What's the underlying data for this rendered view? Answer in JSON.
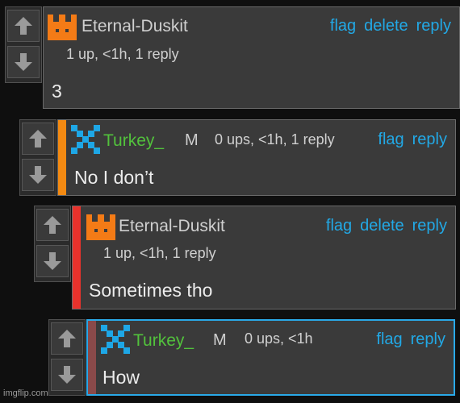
{
  "comments": [
    {
      "username": "Eternal-Duskit",
      "meta": "1 up, <1h, 1 reply",
      "text": "3",
      "actions": [
        "flag",
        "delete",
        "reply"
      ],
      "avatar_icon": "orange-castle-avatar-icon",
      "bar_color": ""
    },
    {
      "username": "Turkey_",
      "badge": "M",
      "meta": "0 ups, <1h, 1 reply",
      "text": "No I don’t",
      "actions": [
        "flag",
        "reply"
      ],
      "avatar_icon": "blue-x-avatar-icon",
      "bar_color": "#f48a12"
    },
    {
      "username": "Eternal-Duskit",
      "meta": "1 up, <1h, 1 reply",
      "text": "Sometimes tho",
      "actions": [
        "flag",
        "delete",
        "reply"
      ],
      "avatar_icon": "orange-castle-avatar-icon",
      "bar_color": "#e8322c"
    },
    {
      "username": "Turkey_",
      "badge": "M",
      "meta": "0 ups, <1h",
      "text": "How",
      "actions": [
        "flag",
        "reply"
      ],
      "avatar_icon": "blue-x-avatar-icon",
      "bar_color": "#8a4a4a"
    }
  ],
  "colors": {
    "link": "#22a9e6",
    "owner_avatar": "#f47b16",
    "mod_avatar": "#1ea7e6",
    "username_green": "#52c23c",
    "highlight_border": "#2aa9e8"
  },
  "watermark": "imgflip.com"
}
